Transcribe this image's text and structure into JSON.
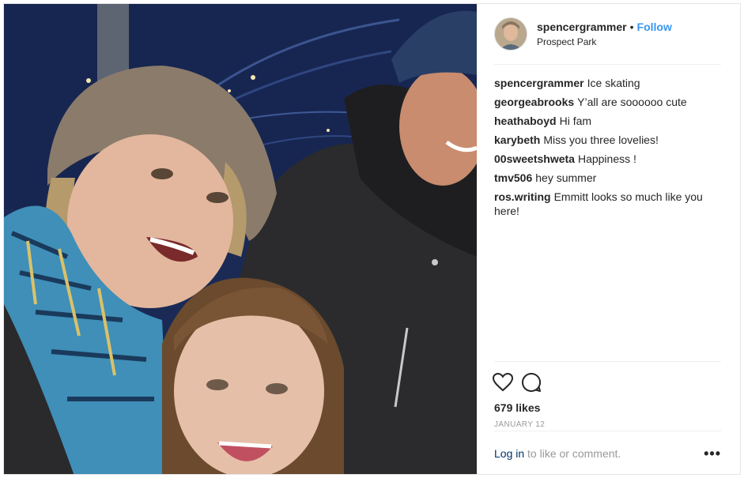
{
  "post": {
    "username": "spencergrammer",
    "separator": "•",
    "follow_label": "Follow",
    "location": "Prospect Park",
    "comments": [
      {
        "user": "spencergrammer",
        "text": "Ice skating"
      },
      {
        "user": "georgeabrooks",
        "text": "Y’all are soooooo cute"
      },
      {
        "user": "heathaboyd",
        "text": "Hi fam"
      },
      {
        "user": "karybeth",
        "text": "Miss you three lovelies!"
      },
      {
        "user": "00sweetshweta",
        "text": "Happiness !"
      },
      {
        "user": "tmv506",
        "text": "hey summer"
      },
      {
        "user": "ros.writing",
        "text": "Emmitt looks so much like you here!"
      }
    ],
    "icons": {
      "like": "heart-icon",
      "comment": "comment-bubble-icon",
      "more": "more-options-icon"
    },
    "likes": "679 likes",
    "date": "JANUARY 12",
    "login_link": "Log in",
    "login_rest": "to like or comment.",
    "more_label": "•••"
  },
  "colors": {
    "follow": "#3897f0",
    "link": "#003569",
    "muted": "#999999",
    "border": "#efefef"
  }
}
